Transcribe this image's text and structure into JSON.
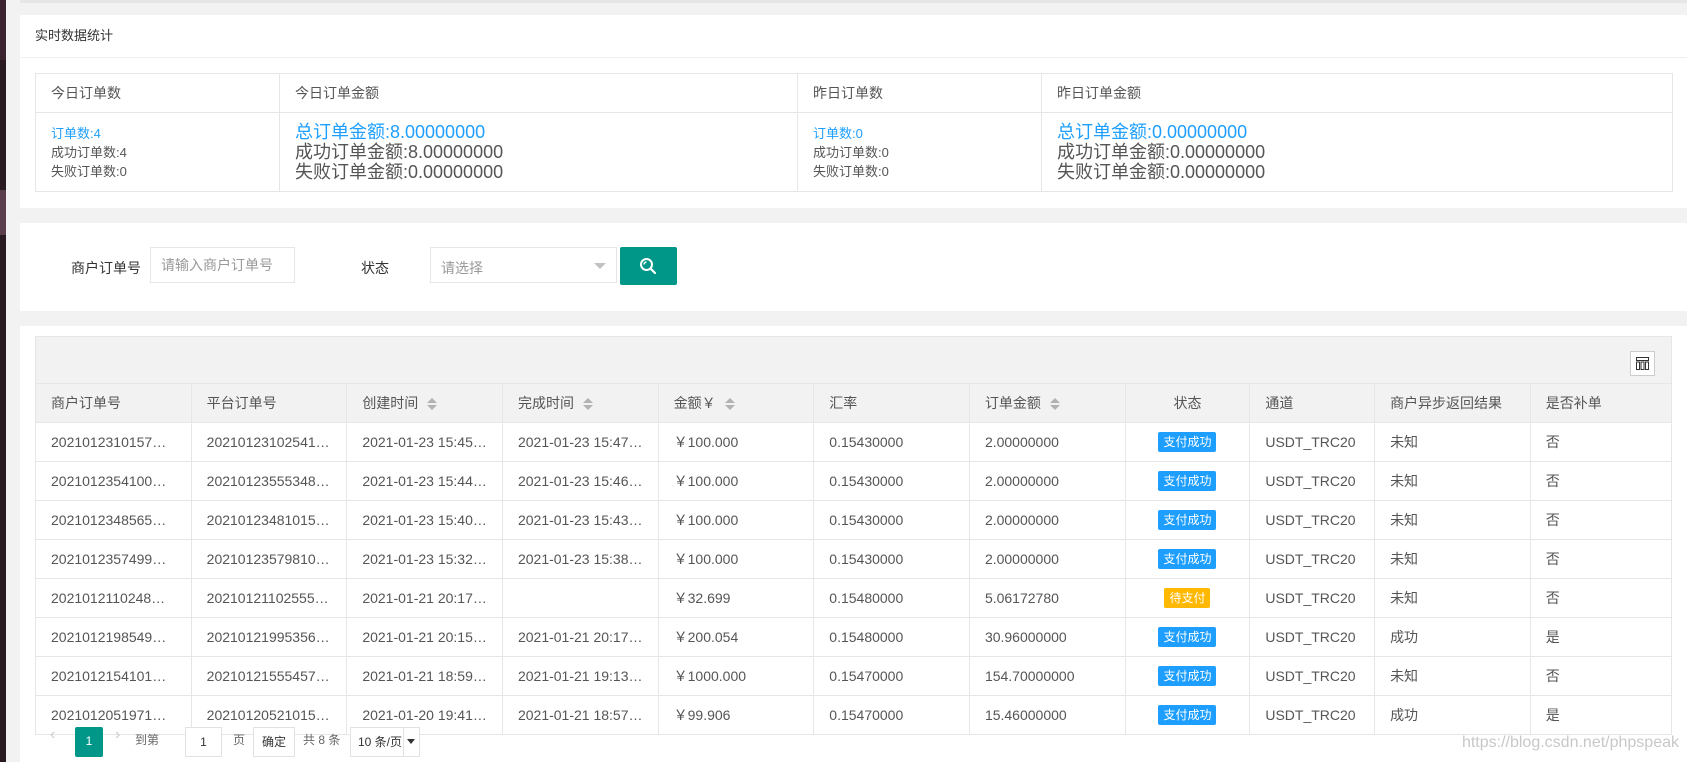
{
  "stats": {
    "title": "实时数据统计",
    "headers": [
      "今日订单数",
      "今日订单金额",
      "昨日订单数",
      "昨日订单金额"
    ],
    "today_count": {
      "total": "订单数:4",
      "success": "成功订单数:4",
      "failed": "失败订单数:0"
    },
    "today_amount": {
      "total": "总订单金额:8.00000000",
      "success": "成功订单金额:8.00000000",
      "failed": "失败订单金额:0.00000000"
    },
    "yesterday_count": {
      "total": "订单数:0",
      "success": "成功订单数:0",
      "failed": "失败订单数:0"
    },
    "yesterday_amount": {
      "total": "总订单金额:0.00000000",
      "success": "成功订单金额:0.00000000",
      "failed": "失败订单金额:0.00000000"
    }
  },
  "filter": {
    "order_label": "商户订单号",
    "order_placeholder": "请输入商户订单号",
    "status_label": "状态",
    "status_placeholder": "请选择",
    "search_icon": "search-icon"
  },
  "table": {
    "columns": [
      "商户订单号",
      "平台订单号",
      "创建时间",
      "完成时间",
      "金额￥",
      "汇率",
      "订单金额",
      "状态",
      "通道",
      "商户异步返回结果",
      "是否补单"
    ],
    "rows": [
      {
        "merchant_no": "2021012310157…",
        "platform_no": "20210123102541…",
        "created": "2021-01-23 15:45…",
        "completed": "2021-01-23 15:47…",
        "amount": "￥100.000",
        "rate": "0.15430000",
        "order_amount": "2.00000000",
        "status": "支付成功",
        "channel": "USDT_TRC20",
        "callback": "未知",
        "supplement": "否"
      },
      {
        "merchant_no": "2021012354100…",
        "platform_no": "20210123555348…",
        "created": "2021-01-23 15:44…",
        "completed": "2021-01-23 15:46…",
        "amount": "￥100.000",
        "rate": "0.15430000",
        "order_amount": "2.00000000",
        "status": "支付成功",
        "channel": "USDT_TRC20",
        "callback": "未知",
        "supplement": "否"
      },
      {
        "merchant_no": "2021012348565…",
        "platform_no": "20210123481015…",
        "created": "2021-01-23 15:40…",
        "completed": "2021-01-23 15:43…",
        "amount": "￥100.000",
        "rate": "0.15430000",
        "order_amount": "2.00000000",
        "status": "支付成功",
        "channel": "USDT_TRC20",
        "callback": "未知",
        "supplement": "否"
      },
      {
        "merchant_no": "2021012357499…",
        "platform_no": "20210123579810…",
        "created": "2021-01-23 15:32…",
        "completed": "2021-01-23 15:38…",
        "amount": "￥100.000",
        "rate": "0.15430000",
        "order_amount": "2.00000000",
        "status": "支付成功",
        "channel": "USDT_TRC20",
        "callback": "未知",
        "supplement": "否"
      },
      {
        "merchant_no": "2021012110248…",
        "platform_no": "20210121102555…",
        "created": "2021-01-21 20:17…",
        "completed": "",
        "amount": "￥32.699",
        "rate": "0.15480000",
        "order_amount": "5.06172780",
        "status": "待支付",
        "channel": "USDT_TRC20",
        "callback": "未知",
        "supplement": "否"
      },
      {
        "merchant_no": "2021012198549…",
        "platform_no": "20210121995356…",
        "created": "2021-01-21 20:15…",
        "completed": "2021-01-21 20:17…",
        "amount": "￥200.054",
        "rate": "0.15480000",
        "order_amount": "30.96000000",
        "status": "支付成功",
        "channel": "USDT_TRC20",
        "callback": "成功",
        "supplement": "是"
      },
      {
        "merchant_no": "2021012154101…",
        "platform_no": "20210121555457…",
        "created": "2021-01-21 18:59…",
        "completed": "2021-01-21 19:13…",
        "amount": "￥1000.000",
        "rate": "0.15470000",
        "order_amount": "154.70000000",
        "status": "支付成功",
        "channel": "USDT_TRC20",
        "callback": "未知",
        "supplement": "否"
      },
      {
        "merchant_no": "2021012051971…",
        "platform_no": "20210120521015…",
        "created": "2021-01-20 19:41…",
        "completed": "2021-01-21 18:57…",
        "amount": "￥99.906",
        "rate": "0.15470000",
        "order_amount": "15.46000000",
        "status": "支付成功",
        "channel": "USDT_TRC20",
        "callback": "成功",
        "supplement": "是"
      }
    ]
  },
  "pager": {
    "current": "1",
    "goto_label": "到第",
    "goto_value": "1",
    "page_unit": "页",
    "confirm": "确定",
    "total": "共 8 条",
    "page_size": "10 条/页"
  },
  "watermark": "https://blog.csdn.net/phpspeak",
  "colors": {
    "primary": "#009688",
    "success_badge": "#1E9FFF",
    "pending_badge": "#FFB800",
    "link": "#1E9FFF"
  }
}
